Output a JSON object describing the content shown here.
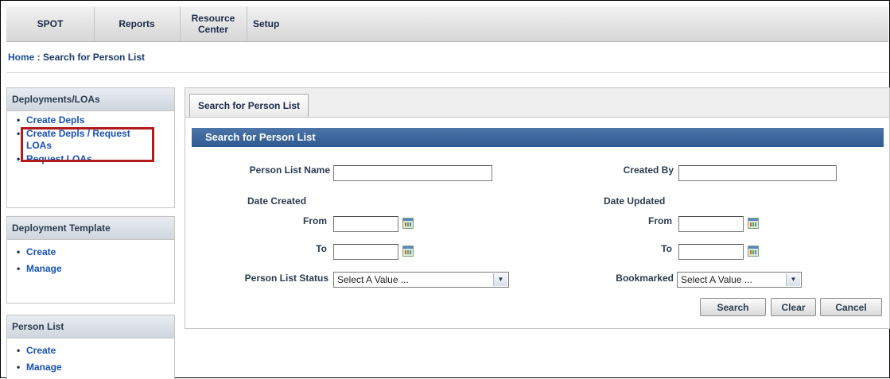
{
  "nav": {
    "items": [
      {
        "label": "SPOT"
      },
      {
        "label": "Reports"
      },
      {
        "label": "Resource\nCenter"
      },
      {
        "label": "Setup"
      }
    ]
  },
  "breadcrumb": {
    "home": "Home",
    "separator": " : ",
    "current": "Search for Person List"
  },
  "sidebar": {
    "deployments": {
      "title": "Deployments/LOAs",
      "items": [
        "Create Depls",
        "Create Depls / Request LOAs",
        "Request LOAs"
      ]
    },
    "template": {
      "title": "Deployment Template",
      "items": [
        "Create",
        "Manage"
      ]
    },
    "person_list": {
      "title": "Person List",
      "items": [
        "Create",
        "Manage"
      ]
    }
  },
  "main": {
    "tab_label": "Search for Person List",
    "section_title": "Search for Person List",
    "form": {
      "person_list_name": {
        "label": "Person List Name",
        "value": ""
      },
      "created_by": {
        "label": "Created By",
        "value": ""
      },
      "date_created_label": "Date Created",
      "date_updated_label": "Date Updated",
      "from_label": "From",
      "to_label": "To",
      "person_list_status": {
        "label": "Person List Status",
        "selected": "Select A Value ..."
      },
      "bookmarked": {
        "label": "Bookmarked",
        "selected": "Select A Value ..."
      }
    },
    "buttons": {
      "search": "Search",
      "clear": "Clear",
      "cancel": "Cancel"
    }
  },
  "colors": {
    "section_bar": "#2e5a92",
    "link": "#1650b8",
    "highlight": "#b01c1c"
  }
}
